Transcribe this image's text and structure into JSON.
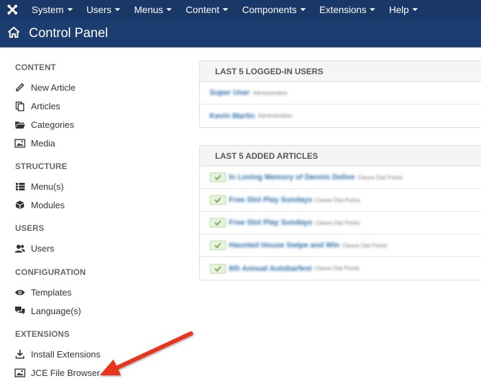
{
  "topnav": {
    "logo_icon": "joomla-logo-icon",
    "items": [
      {
        "label": "System"
      },
      {
        "label": "Users"
      },
      {
        "label": "Menus"
      },
      {
        "label": "Content"
      },
      {
        "label": "Components"
      },
      {
        "label": "Extensions"
      },
      {
        "label": "Help"
      }
    ]
  },
  "header": {
    "title": "Control Panel",
    "icon": "home-icon"
  },
  "sidebar": {
    "content_label": "CONTENT",
    "content_items": [
      {
        "label": "New Article",
        "icon": "pencil-icon"
      },
      {
        "label": "Articles",
        "icon": "copy-icon"
      },
      {
        "label": "Categories",
        "icon": "folder-icon"
      },
      {
        "label": "Media",
        "icon": "image-icon"
      }
    ],
    "structure_label": "STRUCTURE",
    "structure_items": [
      {
        "label": "Menu(s)",
        "icon": "list-icon"
      },
      {
        "label": "Modules",
        "icon": "cube-icon"
      }
    ],
    "users_label": "USERS",
    "users_items": [
      {
        "label": "Users",
        "icon": "users-icon"
      }
    ],
    "configuration_label": "CONFIGURATION",
    "configuration_items": [
      {
        "label": "Templates",
        "icon": "eye-icon"
      },
      {
        "label": "Language(s)",
        "icon": "comments-icon"
      }
    ],
    "extensions_label": "EXTENSIONS",
    "extensions_items": [
      {
        "label": "Install Extensions",
        "icon": "download-icon"
      },
      {
        "label": "JCE File Browser",
        "icon": "image-icon"
      }
    ]
  },
  "logged_in_panel": {
    "title": "LAST 5 LOGGED-IN USERS",
    "rows": [
      {
        "name": "Super User",
        "sub": "Administration"
      },
      {
        "name": "Kevin Martin",
        "sub": "Administration"
      }
    ]
  },
  "articles_panel": {
    "title": "LAST 5 ADDED ARTICLES",
    "rows": [
      {
        "name": "In Loving Memory of Dennis Dolive",
        "sub": "Cleave Dial Points"
      },
      {
        "name": "Free Slot Play Sundays",
        "sub": "Cleave Dial Points"
      },
      {
        "name": "Free Slot Play Sundays",
        "sub": "Cleave Dial Points"
      },
      {
        "name": "Haunted House Swipe and Win",
        "sub": "Cleave Dial Points"
      },
      {
        "name": "6th Annual Autobarfest",
        "sub": "Cleave Dial Points"
      }
    ]
  },
  "annotation": {
    "arrow_color": "#e8351f",
    "points_to": "JCE File Browser"
  },
  "colors": {
    "topnav_bg": "#1a3867",
    "header_bg": "#1c3d6f",
    "link": "#3071a9"
  }
}
